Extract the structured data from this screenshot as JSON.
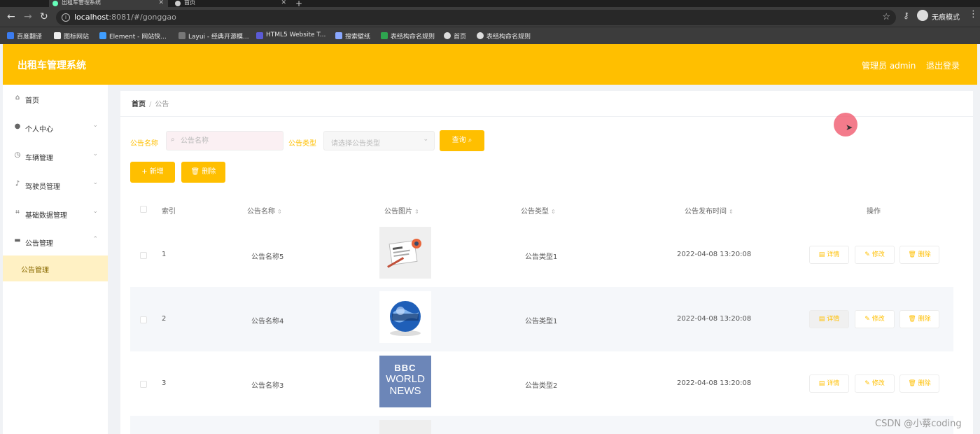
{
  "browser": {
    "tabs": [
      {
        "title": "出租车管理系统",
        "active": true
      },
      {
        "title": "首页",
        "active": false
      }
    ],
    "url_host": "localhost",
    "url_path": ":8081/#/gonggao",
    "profile_label": "无痕模式",
    "bookmarks": [
      "百度翻译",
      "图标网站",
      "Element - 网站快...",
      "Layui - 经典开源模...",
      "HTML5 Website T...",
      "搜索壁纸",
      "表结构命名规则",
      "首页",
      "表结构命名规则"
    ]
  },
  "header": {
    "title": "出租车管理系统",
    "admin_label": "管理员 admin",
    "logout_label": "退出登录"
  },
  "sidebar": {
    "items": [
      {
        "label": "首页",
        "icon": "home-icon"
      },
      {
        "label": "个人中心",
        "icon": "user-icon"
      },
      {
        "label": "车辆管理",
        "icon": "clock-icon"
      },
      {
        "label": "驾驶员管理",
        "icon": "mic-icon"
      },
      {
        "label": "基础数据管理",
        "icon": "bracket-icon"
      },
      {
        "label": "公告管理",
        "icon": "briefcase-icon"
      }
    ],
    "sub_item": "公告管理"
  },
  "breadcrumb": {
    "home": "首页",
    "current": "公告"
  },
  "filters": {
    "name_label": "公告名称",
    "name_placeholder": "公告名称",
    "type_label": "公告类型",
    "type_placeholder": "请选择公告类型",
    "query_label": "查询"
  },
  "actions": {
    "add_label": "新增",
    "delete_label": "删除"
  },
  "table": {
    "headers": {
      "index": "索引",
      "name": "公告名称",
      "image": "公告图片",
      "type": "公告类型",
      "time": "公告发布时间",
      "ops": "操作"
    },
    "op_labels": {
      "detail": "详情",
      "edit": "修改",
      "delete": "删除"
    },
    "rows": [
      {
        "index": "1",
        "name": "公告名称5",
        "type": "公告类型1",
        "time": "2022-04-08 13:20:08",
        "image": "news-paper-image"
      },
      {
        "index": "2",
        "name": "公告名称4",
        "type": "公告类型1",
        "time": "2022-04-08 13:20:08",
        "image": "news-globe-image"
      },
      {
        "index": "3",
        "name": "公告名称3",
        "type": "公告类型2",
        "time": "2022-04-08 13:20:08",
        "image": "bbc-world-news-image",
        "image_text": [
          "BBC",
          "WORLD",
          "NEWS"
        ]
      }
    ]
  },
  "watermark": "CSDN @小蔡coding",
  "colors": {
    "accent": "#ffbf00"
  }
}
